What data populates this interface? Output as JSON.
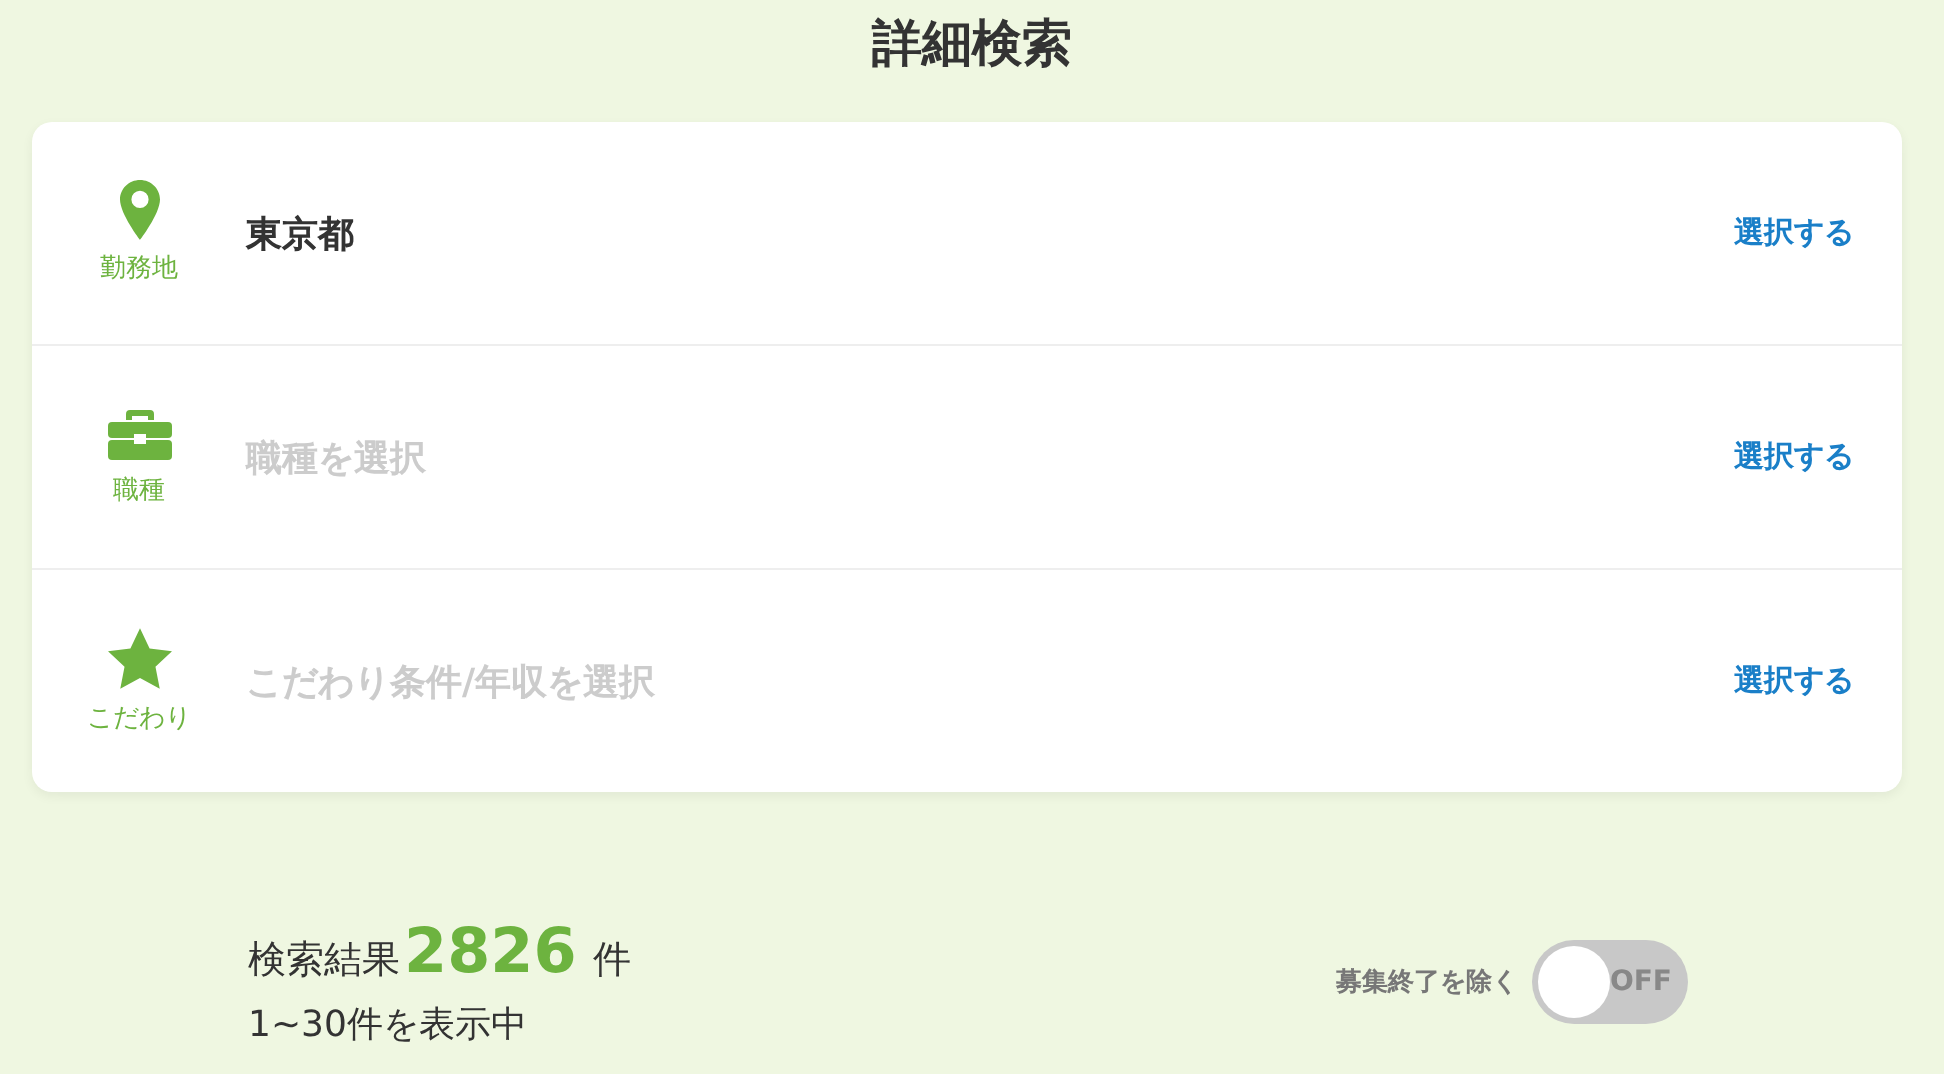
{
  "title": "詳細検索",
  "conditions": [
    {
      "kind": "pin",
      "label": "勤務地",
      "value": "東京都",
      "is_placeholder": false,
      "action": "選択する"
    },
    {
      "kind": "briefcase",
      "label": "職種",
      "value": "職種を選択",
      "is_placeholder": true,
      "action": "選択する"
    },
    {
      "kind": "star",
      "label": "こだわり",
      "value": "こだわり条件/年収を選択",
      "is_placeholder": true,
      "action": "選択する"
    }
  ],
  "results": {
    "prefix": "検索結果",
    "count": "2826",
    "suffix": "件",
    "range": "1~30件を表示中"
  },
  "exclude_toggle": {
    "label": "募集終了を除く",
    "on": false,
    "state_text": "OFF"
  }
}
